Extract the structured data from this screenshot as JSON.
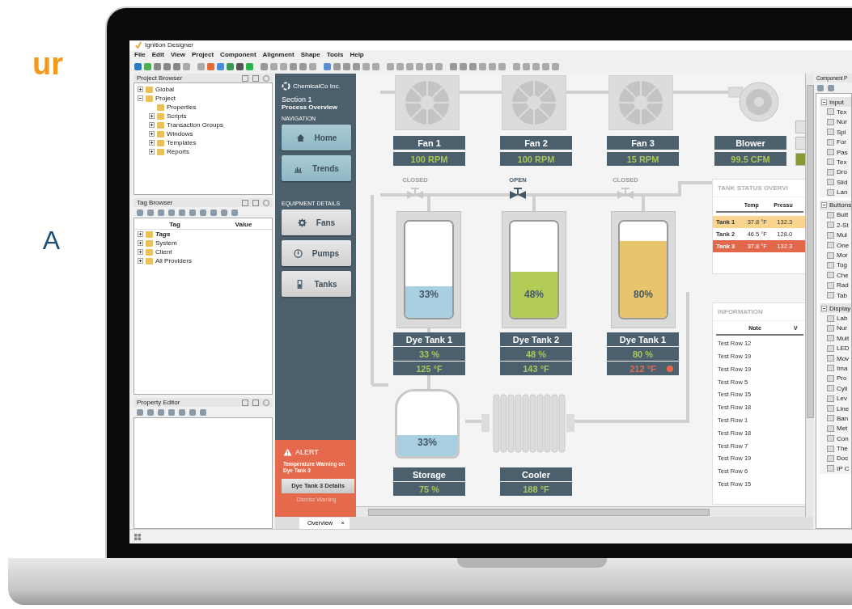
{
  "headline_fragment": "ur",
  "text_fragment": "A",
  "window": {
    "title": "Ignition Designer"
  },
  "menu": [
    "File",
    "Edit",
    "View",
    "Project",
    "Component",
    "Alignment",
    "Shape",
    "Tools",
    "Help"
  ],
  "project_browser": {
    "title": "Project Browser",
    "tree": [
      {
        "label": "Global",
        "expanded": false
      },
      {
        "label": "Project",
        "expanded": true,
        "children": [
          {
            "label": "Properties"
          },
          {
            "label": "Scripts",
            "expanded": false
          },
          {
            "label": "Transaction Groups",
            "expanded": false
          },
          {
            "label": "Windows",
            "expanded": false
          },
          {
            "label": "Templates",
            "expanded": false
          },
          {
            "label": "Reports",
            "expanded": false
          }
        ]
      }
    ]
  },
  "tag_browser": {
    "title": "Tag Browser",
    "columns": [
      "Tag",
      "Value"
    ],
    "tree": [
      {
        "label": "Tags",
        "expanded": false,
        "emphasized": true
      },
      {
        "label": "System",
        "expanded": false,
        "emphasized": false
      },
      {
        "label": "Client",
        "expanded": false,
        "emphasized": false
      },
      {
        "label": "All Providers",
        "expanded": false,
        "emphasized": false
      }
    ]
  },
  "property_editor": {
    "title": "Property Editor"
  },
  "hmi": {
    "company": "ChemicalCo Inc.",
    "section": "Section 1",
    "subtitle": "Process Overview",
    "navigation_heading": "NAVIGATION",
    "navigation": [
      {
        "label": "Home"
      },
      {
        "label": "Trends"
      }
    ],
    "equipment_heading": "EQUIPMENT DETAILS",
    "equipment": [
      {
        "label": "Fans"
      },
      {
        "label": "Pumps"
      },
      {
        "label": "Tanks"
      }
    ],
    "alert": {
      "title": "ALERT",
      "message": "Temperature Warning on Dye Tank 3",
      "button": "Dye Tank 3 Details",
      "link": "Dismiss Warning"
    }
  },
  "fans": [
    {
      "kind": "fan",
      "name": "Fan 1",
      "reading": "100 RPM"
    },
    {
      "kind": "fan",
      "name": "Fan 2",
      "reading": "100 RPM"
    },
    {
      "kind": "fan",
      "name": "Fan 3",
      "reading": "15 RPM"
    },
    {
      "kind": "blower",
      "name": "Blower",
      "reading": "99.5 CFM"
    }
  ],
  "side_buttons": [
    {
      "on": false
    },
    {
      "on": false
    },
    {
      "on": true
    }
  ],
  "valves": [
    {
      "label": "CLOSED",
      "open": false
    },
    {
      "label": "OPEN",
      "open": true
    },
    {
      "label": "CLOSED",
      "open": false
    }
  ],
  "tanks": [
    {
      "name": "Dye Tank 1",
      "percent": "33%",
      "level": 0.33,
      "color": "#a9d0e0",
      "fill_reading": "33 %",
      "temperature": "125 °F",
      "alarm": false
    },
    {
      "name": "Dye Tank 2",
      "percent": "48%",
      "level": 0.48,
      "color": "#b3cc57",
      "fill_reading": "48 %",
      "temperature": "143 °F",
      "alarm": false
    },
    {
      "name": "Dye Tank 1",
      "percent": "80%",
      "level": 0.8,
      "color": "#e8c46c",
      "fill_reading": "80 %",
      "temperature": "212 °F",
      "alarm": true
    }
  ],
  "storage": {
    "percent": "33%",
    "level": 0.33,
    "name": "Storage",
    "reading": "75 %"
  },
  "cooler": {
    "name": "Cooler",
    "reading": "188 °F"
  },
  "tank_status": {
    "title": "TANK STATUS OVERVI",
    "columns": [
      "Temp",
      "Pressu"
    ],
    "rows": [
      {
        "name": "Tank 1",
        "temp": "37.8 °F",
        "pressure": "132.3",
        "color": "#f8d48e",
        "alarm": false
      },
      {
        "name": "Tank 2",
        "temp": "46.5 °F",
        "pressure": "128.0",
        "color": "#ffffff",
        "alarm": false
      },
      {
        "name": "Tank 3",
        "temp": "37.8 °F",
        "pressure": "132.3",
        "color": "#e2674b",
        "alarm": true
      }
    ]
  },
  "information": {
    "title": "INFORMATION",
    "columns": [
      "Note",
      "V"
    ],
    "rows": [
      "Test Row 12",
      "Test Row 19",
      "Test Row 19",
      "Test Row 5",
      "Test Row 15",
      "Test Row 18",
      "Test Row 1",
      "Test Row 18",
      "Test Row 7",
      "Test Row 19",
      "Test Row 6",
      "Test Row 15"
    ]
  },
  "tab": {
    "label": "Overview",
    "close": "×"
  },
  "component_palette": {
    "title": "Component P",
    "groups": [
      {
        "label": "Input",
        "expanded": true,
        "items": [
          "Tex",
          "Nur",
          "Spi",
          "For",
          "Pas",
          "Tex",
          "Dro",
          "Slid",
          "Lan"
        ]
      },
      {
        "label": "Buttons",
        "expanded": true,
        "items": [
          "Butt",
          "2-St",
          "Mul",
          "One",
          "Mor",
          "Tog",
          "Che",
          "Rad",
          "Tab"
        ]
      },
      {
        "label": "Display",
        "expanded": true,
        "items": [
          "Lab",
          "Nur",
          "Mult",
          "LED",
          "Mov",
          "Ima",
          "Pro",
          "Cyli",
          "Lev",
          "Line",
          "Ban",
          "Met",
          "Con",
          "The",
          "Doc",
          "IP C"
        ]
      }
    ]
  }
}
